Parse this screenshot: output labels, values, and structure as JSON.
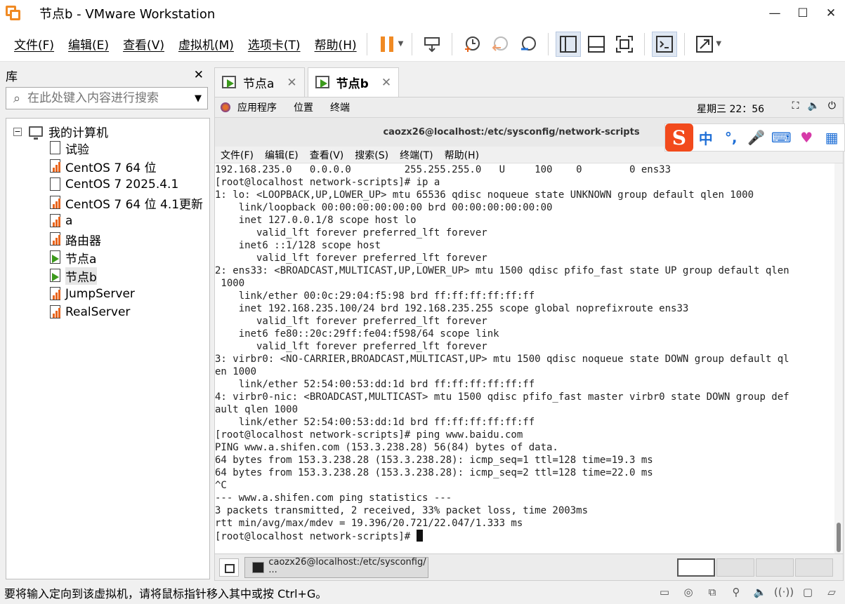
{
  "window": {
    "title": "节点b - VMware Workstation",
    "min": "—",
    "max": "☐",
    "close": "✕"
  },
  "menu": [
    "文件(F)",
    "编辑(E)",
    "查看(V)",
    "虚拟机(M)",
    "选项卡(T)",
    "帮助(H)"
  ],
  "library": {
    "title": "库",
    "close": "✕",
    "search_placeholder": "在此处键入内容进行搜索",
    "root": "我的计算机",
    "items": [
      "试验",
      "CentOS 7 64 位",
      "CentOS 7 2025.4.1",
      "CentOS 7 64 位 4.1更新",
      "a",
      "路由器",
      "节点a",
      "节点b",
      "JumpServer",
      "RealServer"
    ]
  },
  "tabs": [
    {
      "label": "节点a"
    },
    {
      "label": "节点b"
    }
  ],
  "tab_close": "✕",
  "guest": {
    "gnome_menu": [
      "应用程序",
      "位置",
      "终端"
    ],
    "clock": "星期三 22：56",
    "terminal_title": "caozx26@localhost:/etc/sysconfig/network-scripts",
    "terminal_menu": [
      "文件(F)",
      "编辑(E)",
      "查看(V)",
      "搜索(S)",
      "终端(T)",
      "帮助(H)"
    ],
    "terminal_lines": [
      "192.168.235.0   0.0.0.0         255.255.255.0   U     100    0        0 ens33",
      "[root@localhost network-scripts]# ip a",
      "1: lo: <LOOPBACK,UP,LOWER_UP> mtu 65536 qdisc noqueue state UNKNOWN group default qlen 1000",
      "    link/loopback 00:00:00:00:00:00 brd 00:00:00:00:00:00",
      "    inet 127.0.0.1/8 scope host lo",
      "       valid_lft forever preferred_lft forever",
      "    inet6 ::1/128 scope host",
      "       valid_lft forever preferred_lft forever",
      "2: ens33: <BROADCAST,MULTICAST,UP,LOWER_UP> mtu 1500 qdisc pfifo_fast state UP group default qlen",
      " 1000",
      "    link/ether 00:0c:29:04:f5:98 brd ff:ff:ff:ff:ff:ff",
      "    inet 192.168.235.100/24 brd 192.168.235.255 scope global noprefixroute ens33",
      "       valid_lft forever preferred_lft forever",
      "    inet6 fe80::20c:29ff:fe04:f598/64 scope link",
      "       valid_lft forever preferred_lft forever",
      "3: virbr0: <NO-CARRIER,BROADCAST,MULTICAST,UP> mtu 1500 qdisc noqueue state DOWN group default ql",
      "en 1000",
      "    link/ether 52:54:00:53:dd:1d brd ff:ff:ff:ff:ff:ff",
      "4: virbr0-nic: <BROADCAST,MULTICAST> mtu 1500 qdisc pfifo_fast master virbr0 state DOWN group def",
      "ault qlen 1000",
      "    link/ether 52:54:00:53:dd:1d brd ff:ff:ff:ff:ff:ff",
      "[root@localhost network-scripts]# ping www.baidu.com",
      "PING www.a.shifen.com (153.3.238.28) 56(84) bytes of data.",
      "64 bytes from 153.3.238.28 (153.3.238.28): icmp_seq=1 ttl=128 time=19.3 ms",
      "64 bytes from 153.3.238.28 (153.3.238.28): icmp_seq=2 ttl=128 time=22.0 ms",
      "^C",
      "--- www.a.shifen.com ping statistics ---",
      "3 packets transmitted, 2 received, 33% packet loss, time 2003ms",
      "rtt min/avg/max/mdev = 19.396/20.721/22.047/1.333 ms"
    ],
    "prompt": "[root@localhost network-scripts]# ",
    "taskbar_item": "caozx26@localhost:/etc/sysconfig/···"
  },
  "ime": {
    "logo": "S",
    "chinese": "中",
    "punct": "°,"
  },
  "status": {
    "message": "要将输入定向到该虚拟机，请将鼠标指针移入其中或按 Ctrl+G。"
  },
  "colors": {
    "accent": "#f08a24",
    "play": "#3c9a1c",
    "ime": "#f24a1c"
  }
}
